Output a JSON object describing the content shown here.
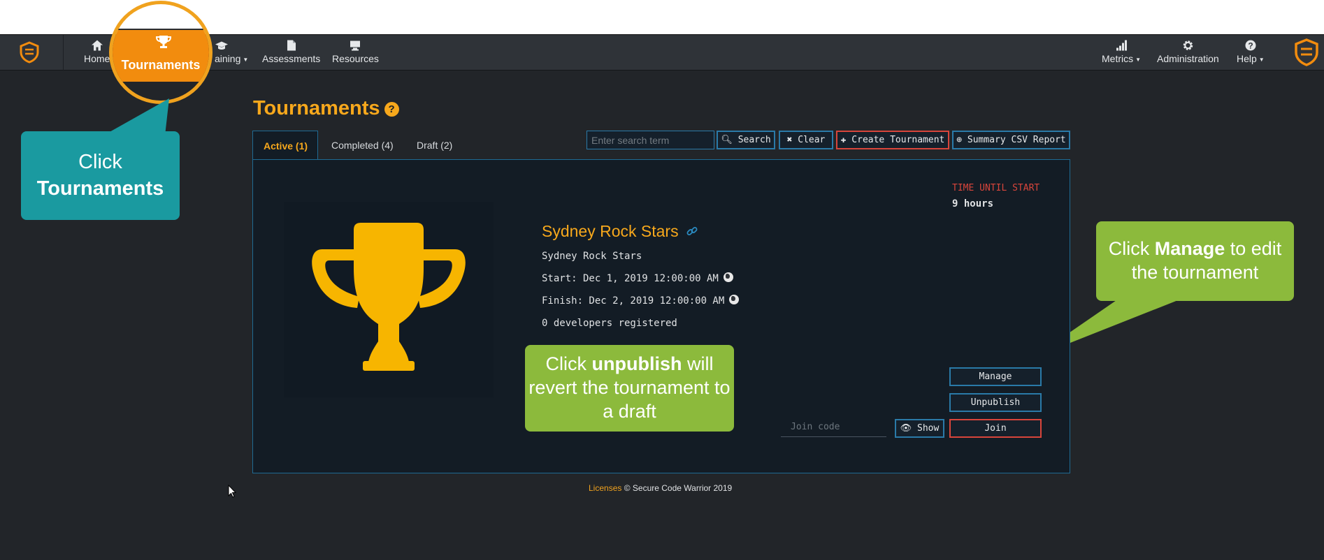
{
  "nav": {
    "items": [
      {
        "label": "Home",
        "icon": "home-icon"
      },
      {
        "label": "aining",
        "icon": "graduation-cap-icon"
      },
      {
        "label": "Assessments",
        "icon": "document-icon"
      },
      {
        "label": "Resources",
        "icon": "monitor-icon"
      },
      {
        "label": "Metrics",
        "icon": "bar-chart-icon"
      },
      {
        "label": "Administration",
        "icon": "gear-icon"
      },
      {
        "label": "Help",
        "icon": "question-icon"
      }
    ],
    "highlight_label": "Tournaments"
  },
  "callouts": {
    "teal": {
      "line1": "Click",
      "line2": "Tournaments"
    },
    "manage": {
      "pre": "Click ",
      "bold": "Manage",
      "post": " to edit the tournament"
    },
    "unpublish": {
      "pre": "Click ",
      "bold": "unpublish",
      "post": " will revert the tournament to a draft"
    }
  },
  "page": {
    "title": "Tournaments",
    "tabs": [
      {
        "label": "Active (1)",
        "active": true
      },
      {
        "label": "Completed (4)",
        "active": false
      },
      {
        "label": "Draft (2)",
        "active": false
      }
    ],
    "search_placeholder": "Enter search term",
    "buttons": {
      "search": "Search",
      "clear": "Clear",
      "create": "Create Tournament",
      "summary": "Summary CSV Report"
    }
  },
  "tournament": {
    "name": "Sydney Rock Stars",
    "description": "Sydney Rock Stars",
    "start": "Start: Dec 1, 2019 12:00:00 AM",
    "finish": "Finish: Dec 2, 2019 12:00:00 AM",
    "registered": "0 developers registered",
    "time_label": "TIME UNTIL START",
    "time_value": "9 hours",
    "manage": "Manage",
    "unpublish": "Unpublish",
    "join_placeholder": "Join code",
    "show": "Show",
    "join": "Join"
  },
  "footer": {
    "licenses": "Licenses",
    "copyright": "© Secure Code Warrior 2019"
  },
  "colors": {
    "accent": "#f7a81c",
    "teal": "#1a9aa0",
    "green": "#8cba3c",
    "red": "#d8453b",
    "blue_border": "#2a7aa8"
  }
}
